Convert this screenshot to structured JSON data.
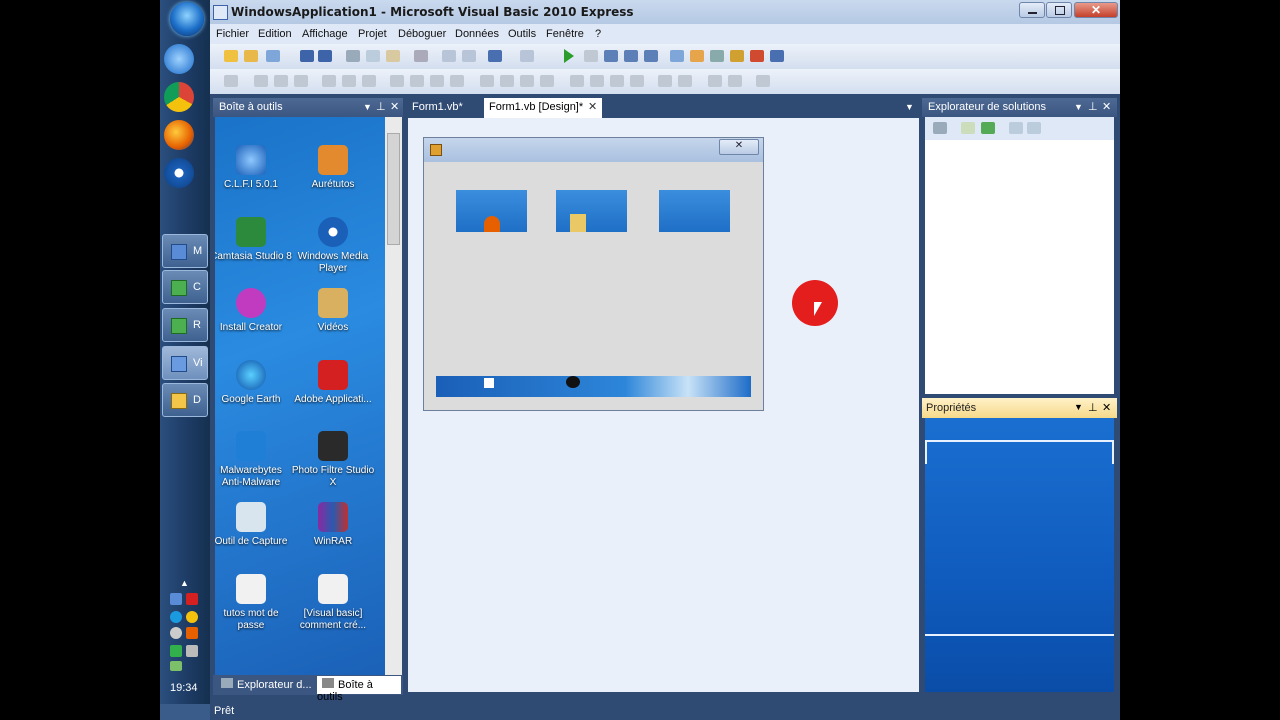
{
  "window": {
    "title": "WindowsApplication1 - Microsoft Visual Basic 2010 Express"
  },
  "menu": {
    "items": [
      "Fichier",
      "Edition",
      "Affichage",
      "Projet",
      "Déboguer",
      "Données",
      "Outils",
      "Fenêtre",
      "?"
    ]
  },
  "taskbar": {
    "buttons": [
      {
        "label": "M",
        "icon": "app-icon"
      },
      {
        "label": "C",
        "icon": "camtasia-icon"
      },
      {
        "label": "R",
        "icon": "recorder-icon"
      },
      {
        "label": "Vi",
        "icon": "visual-basic-icon"
      },
      {
        "label": "D",
        "icon": "folder-icon"
      }
    ],
    "clock": "19:34"
  },
  "toolbox": {
    "title": "Boîte à outils",
    "desktop_icons": [
      {
        "label": "C.L.F.I 5.0.1"
      },
      {
        "label": "Aurétutos"
      },
      {
        "label": "Camtasia Studio 8"
      },
      {
        "label": "Windows Media Player"
      },
      {
        "label": "Install Creator"
      },
      {
        "label": "Vidéos"
      },
      {
        "label": "Google Earth"
      },
      {
        "label": "Adobe Applicati..."
      },
      {
        "label": "Malwarebytes Anti-Malware"
      },
      {
        "label": "Photo Filtre Studio X"
      },
      {
        "label": "Outil de Capture"
      },
      {
        "label": "WinRAR"
      },
      {
        "label": "tutos mot de passe"
      },
      {
        "label": "[Visual basic] comment cré..."
      }
    ],
    "bottom_tabs": [
      "Explorateur d...",
      "Boîte à outils"
    ]
  },
  "documents": {
    "tabs": [
      "Form1.vb*",
      "Form1.vb [Design]*"
    ],
    "active_tab": 1
  },
  "form_designer": {
    "close_glyph": "✕"
  },
  "solution_explorer": {
    "title": "Explorateur de solutions"
  },
  "properties": {
    "title": "Propriétés"
  },
  "status": {
    "text": "Prêt"
  },
  "colors": {
    "accent": "#3b5680",
    "recording_cursor": "#e41d1d",
    "desktop_blue": "#1a73c8"
  }
}
